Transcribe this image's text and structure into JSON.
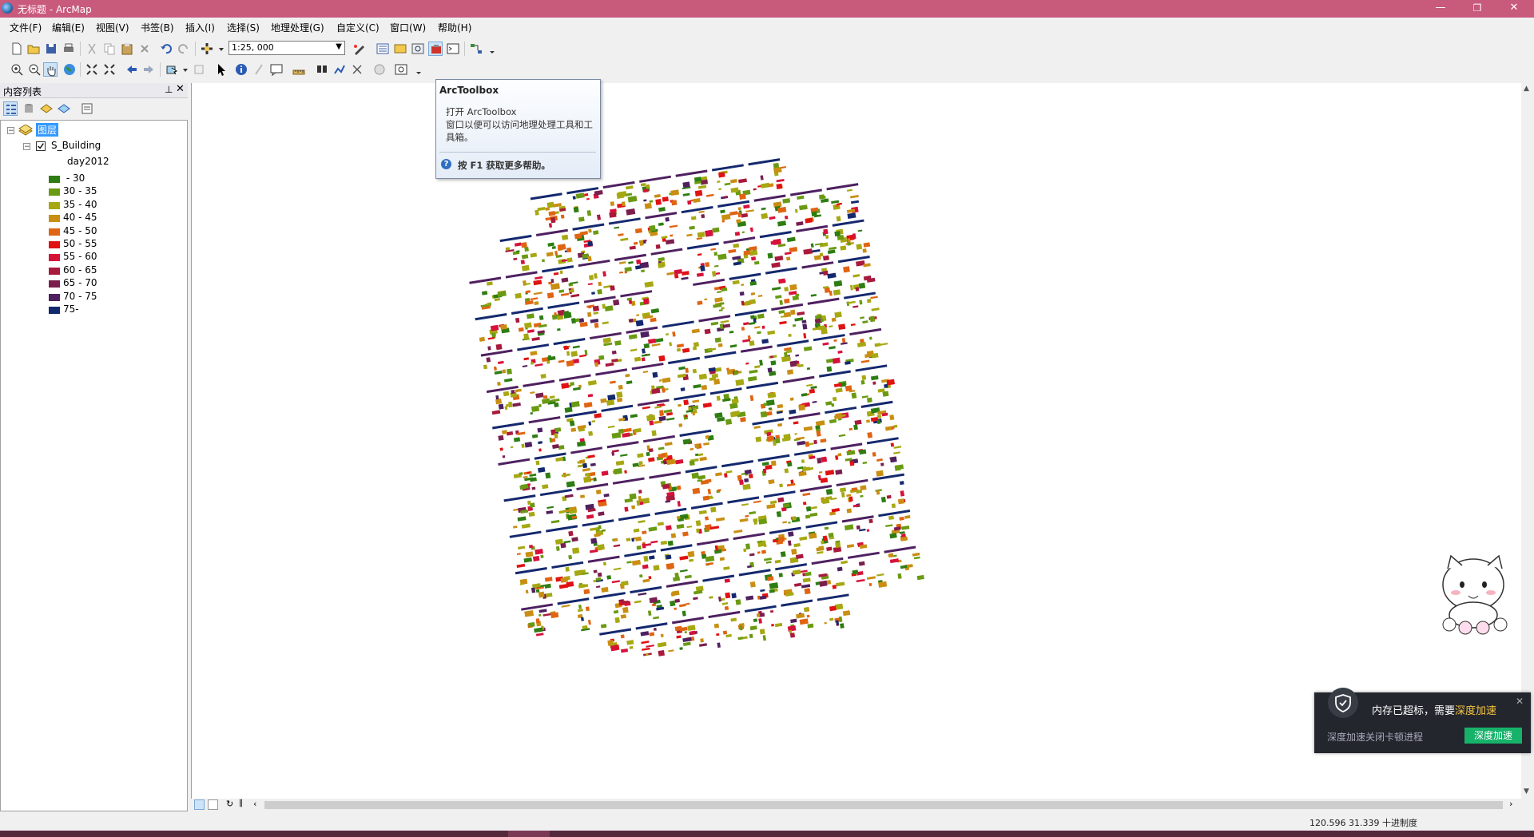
{
  "window": {
    "title": "无标题 - ArcMap",
    "minimize": "—",
    "maximize": "❐",
    "close": "✕"
  },
  "menu": [
    "文件(F)",
    "编辑(E)",
    "视图(V)",
    "书签(B)",
    "插入(I)",
    "选择(S)",
    "地理处理(G)",
    "自定义(C)",
    "窗口(W)",
    "帮助(H)"
  ],
  "toolbar": {
    "scale": "1:25, 000"
  },
  "toc": {
    "title": "内容列表",
    "data_frame": "图层",
    "layer": "S_Building",
    "field": "day2012",
    "legend": [
      {
        "label": " - 30",
        "color": "#2e7d12"
      },
      {
        "label": "30 - 35",
        "color": "#6a9a12"
      },
      {
        "label": "35 - 40",
        "color": "#a6a812"
      },
      {
        "label": "40 - 45",
        "color": "#c98e12"
      },
      {
        "label": "45 - 50",
        "color": "#e06412"
      },
      {
        "label": "50 - 55",
        "color": "#e01212"
      },
      {
        "label": "55 - 60",
        "color": "#d6123a"
      },
      {
        "label": "60 - 65",
        "color": "#a81a3c"
      },
      {
        "label": "65 - 70",
        "color": "#7a1e4e"
      },
      {
        "label": "70 - 75",
        "color": "#4e2060"
      },
      {
        "label": "75-",
        "color": "#14286e"
      }
    ]
  },
  "tooltip": {
    "title": "ArcToolbox",
    "line1": "打开 ArcToolbox",
    "line2": "窗口以便可以访问地理处理工具和工具箱。",
    "help": "按 F1 获取更多帮助。"
  },
  "status": {
    "coords": "120.596  31.339 十进制度"
  },
  "notification": {
    "message_prefix": "内存已超标，需要",
    "message_highlight": "深度加速",
    "sub": "深度加速关闭卡顿进程",
    "button": "深度加速"
  }
}
